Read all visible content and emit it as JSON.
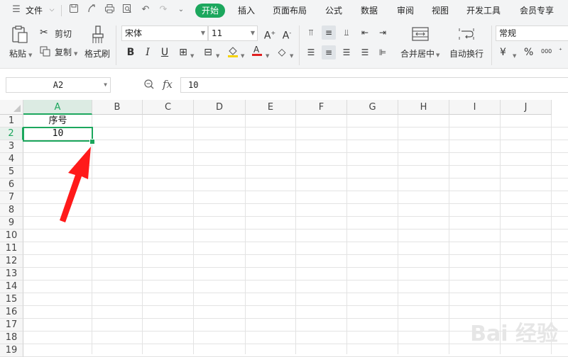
{
  "menubar": {
    "file_label": "文件",
    "tabs": [
      "开始",
      "插入",
      "页面布局",
      "公式",
      "数据",
      "审阅",
      "视图",
      "开发工具",
      "会员专享"
    ]
  },
  "ribbon": {
    "paste_label": "粘贴",
    "cut_label": "剪切",
    "copy_label": "复制",
    "format_painter_label": "格式刷",
    "font_name": "宋体",
    "font_size": "11",
    "merge_center_label": "合并居中",
    "wrap_text_label": "自动换行",
    "number_format": "常规",
    "percent_symbol": "%",
    "currency_symbol": "¥",
    "thousands_symbol": "000"
  },
  "formula_bar": {
    "name_box": "A2",
    "fx_label": "fx",
    "value": "10"
  },
  "sheet": {
    "columns": [
      "A",
      "B",
      "C",
      "D",
      "E",
      "F",
      "G",
      "H",
      "I",
      "J"
    ],
    "rows": [
      "1",
      "2",
      "3",
      "4",
      "5",
      "6",
      "7",
      "8",
      "9",
      "10",
      "11",
      "12",
      "13",
      "14",
      "15",
      "16",
      "17",
      "18",
      "19"
    ],
    "a1": "序号",
    "a2": "10"
  },
  "annotation": {
    "arrow_color": "#ff1a1a"
  },
  "watermark": "Bai 经验",
  "colors": {
    "accent": "#1ca75d",
    "chrome": "#f3f4f5"
  }
}
